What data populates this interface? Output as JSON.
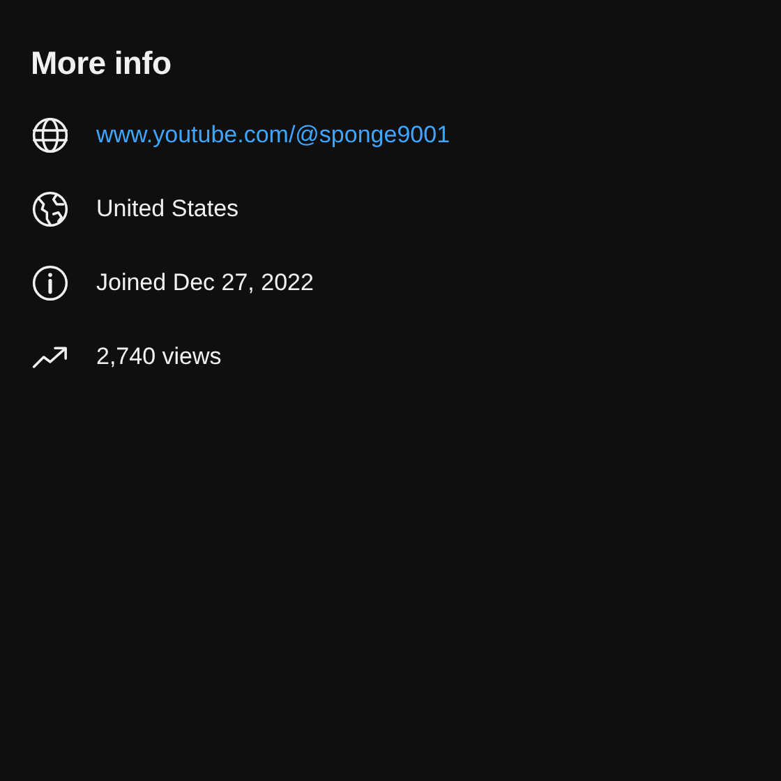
{
  "title": "More info",
  "items": [
    {
      "kind": "link",
      "text": "www.youtube.com/@sponge9001"
    },
    {
      "kind": "location",
      "text": "United States"
    },
    {
      "kind": "joined",
      "text": "Joined Dec 27, 2022"
    },
    {
      "kind": "views",
      "text": "2,740 views"
    }
  ]
}
